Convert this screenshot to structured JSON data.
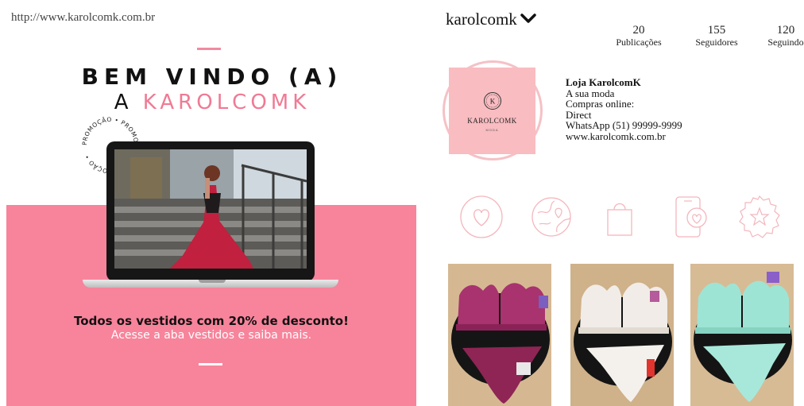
{
  "website": {
    "url": "http://www.karolcomk.com.br",
    "welcome": "BEM VINDO (A)",
    "brand_prefix": "A",
    "brand_name": "KAROLCOMK",
    "stamp_text": "PROMOÇÃO • PROMOÇÃO • PROMOÇÃO •",
    "promo_headline": "Todos os vestidos com 20% de desconto!",
    "promo_sub": "Acesse a aba vestidos e saiba mais.",
    "colors": {
      "accent": "#f7849b",
      "brand_text": "#f07a94"
    }
  },
  "profile": {
    "username": "karolcomk",
    "stats": [
      {
        "value": "20",
        "label": "Publicações"
      },
      {
        "value": "155",
        "label": "Seguidores"
      },
      {
        "value": "120",
        "label": "Seguindo"
      }
    ],
    "avatar": {
      "name": "KAROLCOMK",
      "subtitle": "MODA",
      "monogram": "K",
      "color": "#f8bcc1"
    },
    "bio": {
      "name": "Loja KarolcomK",
      "lines": [
        "A sua moda",
        "Compras online:",
        "Direct",
        "WhatsApp (51) 99999-9999",
        "www.karolcomk.com.br"
      ]
    },
    "highlights": [
      {
        "icon": "heart-icon"
      },
      {
        "icon": "globe-icon"
      },
      {
        "icon": "shopping-bag-icon"
      },
      {
        "icon": "phone-heart-icon"
      },
      {
        "icon": "star-badge-icon"
      }
    ],
    "posts": [
      {
        "color": "#a8336f"
      },
      {
        "color": "#f2ede8"
      },
      {
        "color": "#9ee4d4"
      }
    ],
    "colors": {
      "highlight_stroke": "#f4b6bd"
    }
  }
}
